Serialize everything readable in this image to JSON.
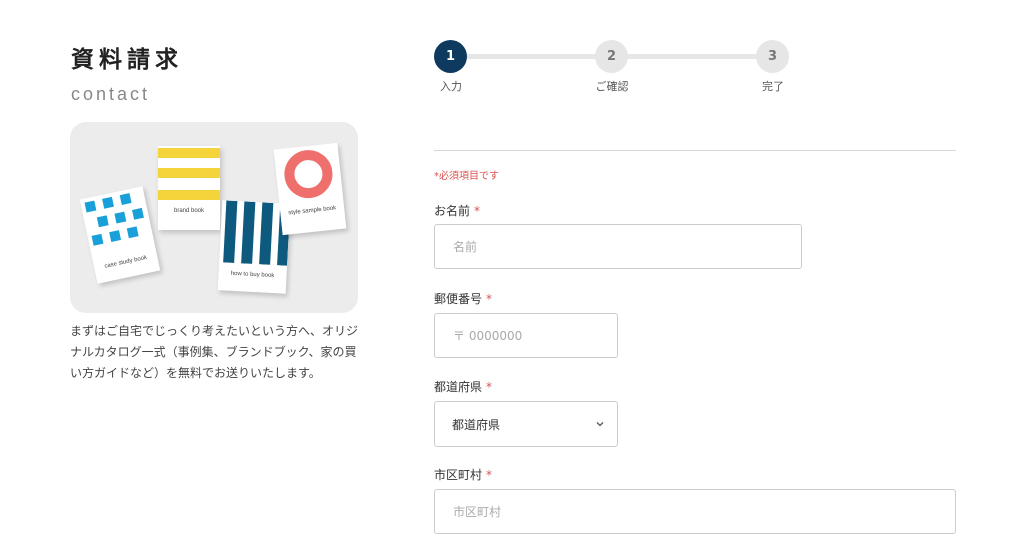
{
  "page": {
    "title": "資料請求",
    "subtitle": "contact"
  },
  "catalog_image": {
    "books": [
      {
        "caption": "case study book",
        "color": "#1aa0d8"
      },
      {
        "caption": "brand book",
        "color": "#f5d33a"
      },
      {
        "caption": "how to buy book",
        "color": "#0e5a7e"
      },
      {
        "caption": "style sample book",
        "color": "#ef6f6c"
      }
    ]
  },
  "lead": {
    "text": "まずはご自宅でじっくり考えたいという方へ、オリジナルカタログ一式（事例集、ブランドブック、家の買い方ガイドなど）を無料でお送りいたします。"
  },
  "stepper": {
    "steps": [
      {
        "number": "1",
        "label": "入力"
      },
      {
        "number": "2",
        "label": "ご確認"
      },
      {
        "number": "3",
        "label": "完了"
      }
    ],
    "active_color": "#0f3a5f",
    "inactive_color": "#e6e6e6"
  },
  "form": {
    "required_note": "*必須項目です",
    "required_mark": "*",
    "name": {
      "label": "お名前",
      "placeholder": "名前",
      "value": ""
    },
    "postal": {
      "label": "郵便番号",
      "placeholder": "〒 0000000",
      "value": ""
    },
    "prefecture": {
      "label": "都道府県",
      "selected": "都道府県"
    },
    "city": {
      "label": "市区町村",
      "placeholder": "市区町村",
      "value": ""
    }
  }
}
